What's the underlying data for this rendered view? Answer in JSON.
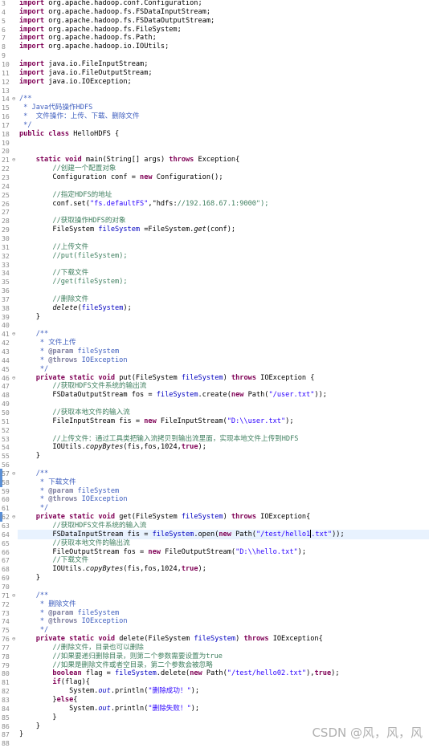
{
  "editor": {
    "lines": [
      {
        "n": "3",
        "t": "import org.apache.hadoop.conf.Configuration;"
      },
      {
        "n": "4",
        "t": "import org.apache.hadoop.fs.FSDataInputStream;"
      },
      {
        "n": "5",
        "t": "import org.apache.hadoop.fs.FSDataOutputStream;"
      },
      {
        "n": "6",
        "t": "import org.apache.hadoop.fs.FileSystem;"
      },
      {
        "n": "7",
        "t": "import org.apache.hadoop.fs.Path;"
      },
      {
        "n": "8",
        "t": "import org.apache.hadoop.io.IOUtils;"
      },
      {
        "n": "9",
        "t": ""
      },
      {
        "n": "10",
        "t": "import java.io.FileInputStream;"
      },
      {
        "n": "11",
        "t": "import java.io.FileOutputStream;"
      },
      {
        "n": "12",
        "t": "import java.io.IOException;"
      },
      {
        "n": "13",
        "t": ""
      },
      {
        "n": "14",
        "t": "/**",
        "fold": "⊖"
      },
      {
        "n": "15",
        "t": " * Java代码操作HDFS"
      },
      {
        "n": "16",
        "t": " *  文件操作：上传、下载、删除文件"
      },
      {
        "n": "17",
        "t": " */"
      },
      {
        "n": "18",
        "t": "public class HelloHDFS {"
      },
      {
        "n": "19",
        "t": ""
      },
      {
        "n": "20",
        "t": ""
      },
      {
        "n": "21",
        "t": "    static void main(String[] args) throws Exception{",
        "fold": "⊖"
      },
      {
        "n": "22",
        "t": "        //创建一个配置对象"
      },
      {
        "n": "23",
        "t": "        Configuration conf = new Configuration();"
      },
      {
        "n": "24",
        "t": ""
      },
      {
        "n": "25",
        "t": "        //指定HDFS的地址"
      },
      {
        "n": "26",
        "t": "        conf.set(\"fs.defaultFS\",\"hdfs://192.168.67.1:9000\");"
      },
      {
        "n": "27",
        "t": ""
      },
      {
        "n": "28",
        "t": "        //获取操作HDFS的对象"
      },
      {
        "n": "29",
        "t": "        FileSystem fileSystem =FileSystem.get(conf);"
      },
      {
        "n": "30",
        "t": ""
      },
      {
        "n": "31",
        "t": "        //上传文件"
      },
      {
        "n": "32",
        "t": "        //put(fileSystem);"
      },
      {
        "n": "33",
        "t": ""
      },
      {
        "n": "34",
        "t": "        //下载文件"
      },
      {
        "n": "35",
        "t": "        //get(fileSystem);"
      },
      {
        "n": "36",
        "t": ""
      },
      {
        "n": "37",
        "t": "        //删除文件"
      },
      {
        "n": "38",
        "t": "        delete(fileSystem);"
      },
      {
        "n": "39",
        "t": "    }"
      },
      {
        "n": "40",
        "t": ""
      },
      {
        "n": "41",
        "t": "    /**",
        "fold": "⊖"
      },
      {
        "n": "42",
        "t": "     * 文件上传"
      },
      {
        "n": "43",
        "t": "     * @param fileSystem"
      },
      {
        "n": "44",
        "t": "     * @throws IOException"
      },
      {
        "n": "45",
        "t": "     */"
      },
      {
        "n": "46",
        "t": "    private static void put(FileSystem fileSystem) throws IOException {",
        "fold": "⊖"
      },
      {
        "n": "47",
        "t": "        //获取HDFS文件系统的输出流"
      },
      {
        "n": "48",
        "t": "        FSDataOutputStream fos = fileSystem.create(new Path(\"/user.txt\"));"
      },
      {
        "n": "49",
        "t": ""
      },
      {
        "n": "50",
        "t": "        //获取本地文件的输入流"
      },
      {
        "n": "51",
        "t": "        FileInputStream fis = new FileInputStream(\"D:\\\\user.txt\");"
      },
      {
        "n": "52",
        "t": ""
      },
      {
        "n": "53",
        "t": "        //上传文件：通过工具类把输入流拷贝到输出流里面，实现本地文件上传到HDFS"
      },
      {
        "n": "54",
        "t": "        IOUtils.copyBytes(fis,fos,1024,true);"
      },
      {
        "n": "55",
        "t": "    }"
      },
      {
        "n": "56",
        "t": ""
      },
      {
        "n": "57",
        "t": "    /**",
        "fold": "⊖",
        "mark": true
      },
      {
        "n": "58",
        "t": "     * 下载文件",
        "mark": true
      },
      {
        "n": "59",
        "t": "     * @param fileSystem"
      },
      {
        "n": "60",
        "t": "     * @throws IOException"
      },
      {
        "n": "61",
        "t": "     */"
      },
      {
        "n": "62",
        "t": "    private static void get(FileSystem fileSystem) throws IOException{",
        "fold": "⊖",
        "mark": true
      },
      {
        "n": "63",
        "t": "        //获取HDFS文件系统的输入流"
      },
      {
        "n": "64",
        "t": "        FSDataInputStream fis = fileSystem.open(new Path(\"/test/hello1.txt\"));",
        "current": true
      },
      {
        "n": "65",
        "t": "        //获取本地文件的输出流"
      },
      {
        "n": "66",
        "t": "        FileOutputStream fos = new FileOutputStream(\"D:\\\\hello.txt\");"
      },
      {
        "n": "67",
        "t": "        //下载文件"
      },
      {
        "n": "68",
        "t": "        IOUtils.copyBytes(fis,fos,1024,true);"
      },
      {
        "n": "69",
        "t": "    }"
      },
      {
        "n": "70",
        "t": ""
      },
      {
        "n": "71",
        "t": "    /**",
        "fold": "⊖"
      },
      {
        "n": "72",
        "t": "     * 删除文件"
      },
      {
        "n": "73",
        "t": "     * @param fileSystem"
      },
      {
        "n": "74",
        "t": "     * @throws IOException"
      },
      {
        "n": "75",
        "t": "     */"
      },
      {
        "n": "76",
        "t": "    private static void delete(FileSystem fileSystem) throws IOException{",
        "fold": "⊖"
      },
      {
        "n": "77",
        "t": "        //删除文件，目录也可以删除"
      },
      {
        "n": "78",
        "t": "        //如果要递归删除目录，则第二个参数需要设置为true"
      },
      {
        "n": "79",
        "t": "        //如果是删除文件或者空目录，第二个参数会被忽略"
      },
      {
        "n": "80",
        "t": "        boolean flag = fileSystem.delete(new Path(\"/test/hello02.txt\"),true);"
      },
      {
        "n": "81",
        "t": "        if(flag){"
      },
      {
        "n": "82",
        "t": "            System.out.println(\"删除成功！\");"
      },
      {
        "n": "83",
        "t": "        }else{"
      },
      {
        "n": "84",
        "t": "            System.out.println(\"删除失败！\");"
      },
      {
        "n": "85",
        "t": "        }"
      },
      {
        "n": "86",
        "t": "    }"
      },
      {
        "n": "87",
        "t": "}"
      },
      {
        "n": "88",
        "t": ""
      }
    ]
  },
  "watermark": "CSDN @风，风，风"
}
